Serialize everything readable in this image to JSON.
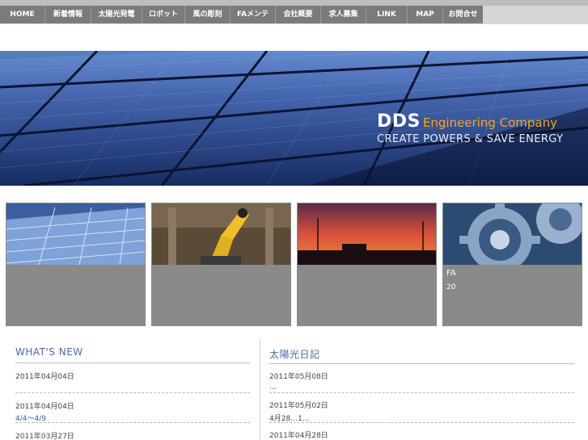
{
  "nav": {
    "items": [
      {
        "label": "HOME",
        "width": 56
      },
      {
        "label": "新着情報",
        "width": 57
      },
      {
        "label": "太陽光発電",
        "width": 63
      },
      {
        "label": "ロボット",
        "width": 53
      },
      {
        "label": "風の彫刻",
        "width": 56
      },
      {
        "label": "FAメンテ",
        "width": 56
      },
      {
        "label": "会社概要",
        "width": 56
      },
      {
        "label": "求人募集",
        "width": 56
      },
      {
        "label": "LINK",
        "width": 51
      },
      {
        "label": "MAP",
        "width": 44
      },
      {
        "label": "お問合せ",
        "width": 49
      }
    ]
  },
  "tagline": "",
  "hero": {
    "brand": "DDS",
    "brand_sub": "Engineering Company",
    "slogan": "CREATE POWERS & SAVE ENERGY"
  },
  "cards": [
    {
      "title": "",
      "desc": ""
    },
    {
      "title": "",
      "desc": ""
    },
    {
      "title": "",
      "desc": ""
    },
    {
      "title": "FA",
      "desc": "20"
    }
  ],
  "news": {
    "title": "WHAT'S NEW",
    "entries": [
      {
        "date": "2011年04月04日",
        "link": ""
      },
      {
        "date": "2011年04月04日",
        "link": "4/4〜4/9"
      },
      {
        "date": "2011年03月27日",
        "link": ""
      }
    ]
  },
  "diary": {
    "title": "太陽光日記",
    "entries": [
      {
        "date": "2011年05月08日",
        "link": "",
        "excerpt": "..."
      },
      {
        "date": "2011年05月02日",
        "link": "",
        "excerpt": "4月28…1…"
      },
      {
        "date": "2011年04月28日",
        "link": "",
        "excerpt": ""
      }
    ]
  }
}
